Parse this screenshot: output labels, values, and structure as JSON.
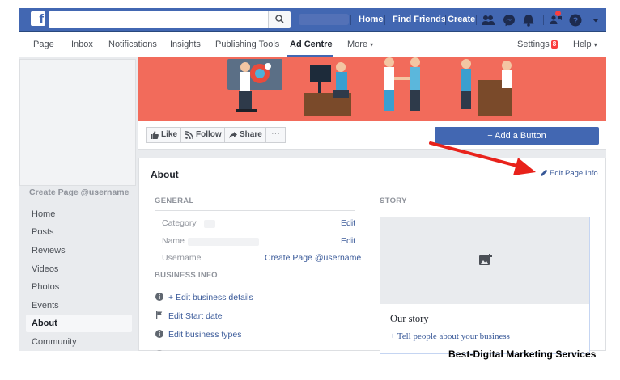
{
  "topbar": {
    "logo": "f",
    "links": [
      "Home",
      "Find Friends",
      "Create"
    ],
    "icons": [
      "friends-icon",
      "messenger-icon",
      "notifications-icon",
      "page-people-icon",
      "help-icon",
      "dropdown-icon"
    ],
    "color": "#4267b2"
  },
  "pagenav": {
    "items": [
      "Page",
      "Inbox",
      "Notifications",
      "Insights",
      "Publishing Tools",
      "Ad Centre",
      "More"
    ],
    "more_caret": "▾",
    "settings": "Settings",
    "settings_badge": "8",
    "help": "Help",
    "help_caret": "▾",
    "active": "Ad Centre"
  },
  "sidebar": {
    "username": "Create Page @username",
    "items": [
      "Home",
      "Posts",
      "Reviews",
      "Videos",
      "Photos",
      "Events",
      "About",
      "Community"
    ],
    "active": "About"
  },
  "cover": {
    "color": "#f26b5b"
  },
  "actions": {
    "like": "Like",
    "follow": "Follow",
    "share": "Share",
    "more": "···",
    "add_button": "+ Add a Button"
  },
  "about": {
    "title": "About",
    "edit_page_info": "Edit Page Info",
    "general_heading": "GENERAL",
    "fields": [
      {
        "label": "Category",
        "action": "Edit"
      },
      {
        "label": "Name",
        "action": "Edit"
      },
      {
        "label": "Username",
        "action": "Create Page @username"
      }
    ],
    "business_heading": "BUSINESS INFO",
    "business_rows": [
      "+ Edit business details",
      "Edit Start date",
      "Edit business types"
    ],
    "story_heading": "STORY",
    "story_title": "Our story",
    "story_link": "+ Tell people about your business"
  },
  "watermark": "Best-Digital Marketing Services",
  "annotation_color": "#e8221b"
}
